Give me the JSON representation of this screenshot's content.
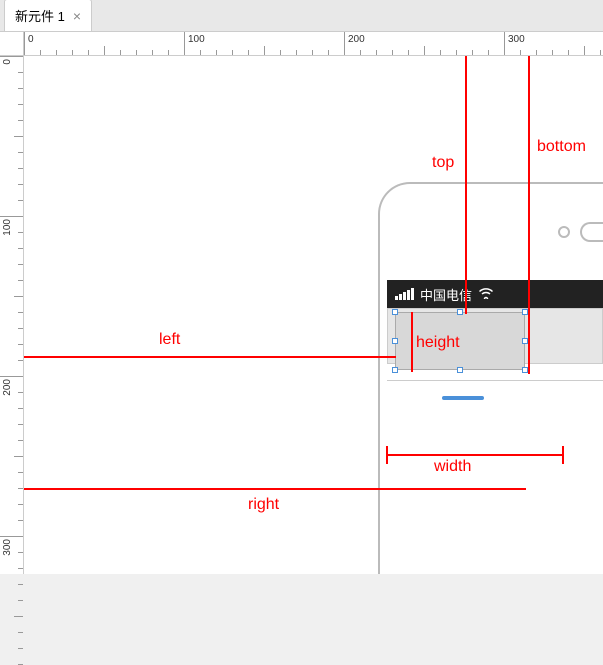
{
  "tab": {
    "title": "新元件 1",
    "close": "×"
  },
  "ruler": {
    "ticks": [
      0,
      100,
      200,
      300
    ]
  },
  "phone": {
    "statusbar": {
      "carrier": "中国电信"
    }
  },
  "annotations": {
    "top": "top",
    "bottom": "bottom",
    "left": "left",
    "right": "right",
    "width": "width",
    "height": "height"
  }
}
